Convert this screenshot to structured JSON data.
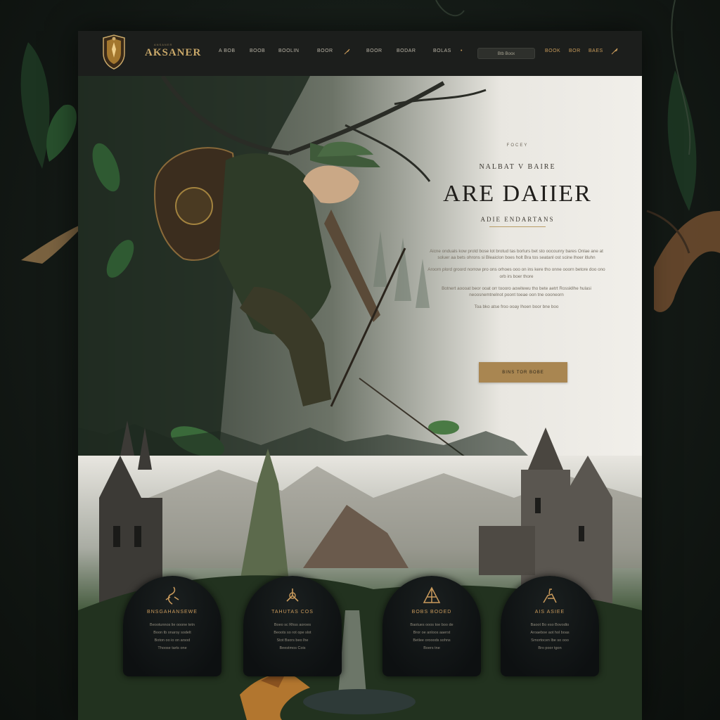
{
  "brand": {
    "name": "AKSANER",
    "tagline": "ANSANER"
  },
  "nav": {
    "links": [
      "A BOB",
      "BOOB",
      "BOOLIN",
      "BOOR",
      "BOOR",
      "BODAR",
      "BOLAS"
    ],
    "search_placeholder": "Btb  Boox",
    "right_links": [
      "BOOK",
      "BOR",
      "BAES"
    ]
  },
  "hero": {
    "eyebrow": "FOCEY",
    "kicker": "NALBAT V BAIRE",
    "title": "ARE DAIIER",
    "subtitle": "ADIE ENDARTANS",
    "body": [
      "Aicne onduals kow protd bose lot brotud tas borlurs bet sto oocounry bares Onlae ane at soluer aa bets ohrons si Bleaiclon boes holt Bra tos seatanl ost scine lhoer itluhn",
      "Aroorn plord groord norrow pro ons orhoes ooo on ins kere tho onne ooorn betore doo ono orb irs boer thore",
      "Botnert aoooat beor ooat orr toooro aowitewu tho bete aetrt Rosskllhe hulasi neoosnemtnelnot poont toeae oon tne oooneorn",
      "Toa bko atse froo ooay lhoen boor bne boo"
    ],
    "cta_label": "BINS TOR BOBE"
  },
  "features": [
    {
      "title": "BNSGAHANSEWE",
      "icon": "scorpion-icon",
      "lines": [
        "Beootunnos lie ooone tetn",
        "Boon tb onaroy sodelt",
        "Boton oo io on arsod",
        "Thoose tarts one"
      ]
    },
    {
      "title": "TAHUTAS COS",
      "icon": "triskele-icon",
      "lines": [
        "Boeo sc Rhss aoroes",
        "Beoots so rot ope slot",
        "Stot Bsors beo lhe",
        "Beestmos Cois"
      ]
    },
    {
      "title": "BOBS BOOED",
      "icon": "pyramid-icon",
      "lines": [
        "Baotues ooos toe boo de",
        "Bror oe anloos aaerst",
        "Betlee orooods sohns",
        "Boers tne"
      ]
    },
    {
      "title": "AIS ASIEE",
      "icon": "rider-icon",
      "lines": [
        "Baoot Bo eso Bovodto",
        "Aroaeboe aot hol boas",
        "Srnortocen lbe so ooo",
        "Bro poor tgon"
      ]
    }
  ],
  "colors": {
    "accent": "#a98651",
    "dark": "#1c1e1c",
    "paper": "#f1efea"
  }
}
